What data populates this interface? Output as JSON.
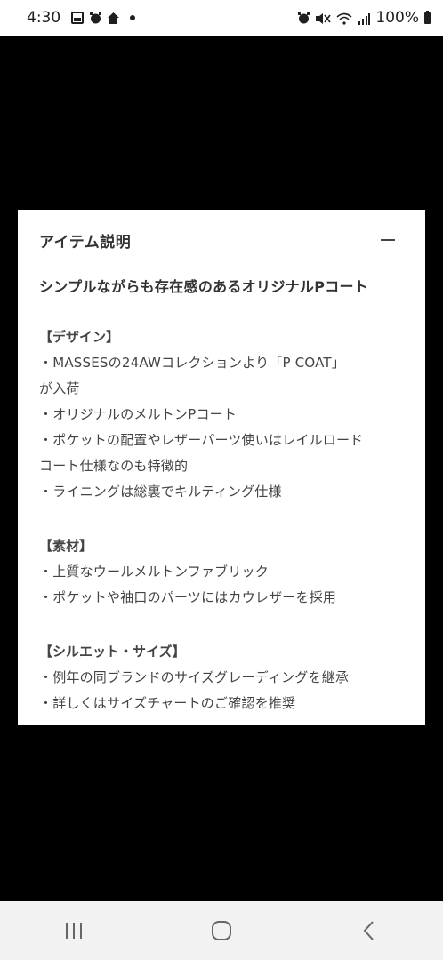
{
  "status_bar": {
    "time": "4:30",
    "battery": "100%",
    "left_icons": [
      "gallery-icon",
      "alarm-icon",
      "home-icon",
      "notification-dot-icon"
    ],
    "right_icons": [
      "alarm-icon",
      "mute-icon",
      "wifi-icon",
      "signal-icon",
      "battery-icon"
    ]
  },
  "card": {
    "title": "アイテム説明",
    "headline": "シンプルながらも存在感のあるオリジナルPコート",
    "sections": [
      {
        "title": "【デザイン】",
        "lines": [
          "・MASSESの24AWコレクションより「P COAT」",
          "が入荷",
          "・オリジナルのメルトンPコート",
          "・ポケットの配置やレザーパーツ使いはレイルロード",
          "コート仕様なのも特徴的",
          "・ライニングは総裏でキルティング仕様"
        ]
      },
      {
        "title": "【素材】",
        "lines": [
          "・上質なウールメルトンファブリック",
          "・ポケットや袖口のパーツにはカウレザーを採用"
        ]
      },
      {
        "title": "【シルエット・サイズ】",
        "lines": [
          "・例年の同ブランドのサイズグレーディングを継承",
          "・詳しくはサイズチャートのご確認を推奨"
        ]
      }
    ]
  },
  "nav_bar": {
    "buttons": [
      "recent-apps-icon",
      "home-button-icon",
      "back-icon"
    ]
  },
  "colors": {
    "background": "#000000",
    "card": "#ffffff",
    "text": "#333333",
    "nav_bar": "#f2f2f2"
  }
}
